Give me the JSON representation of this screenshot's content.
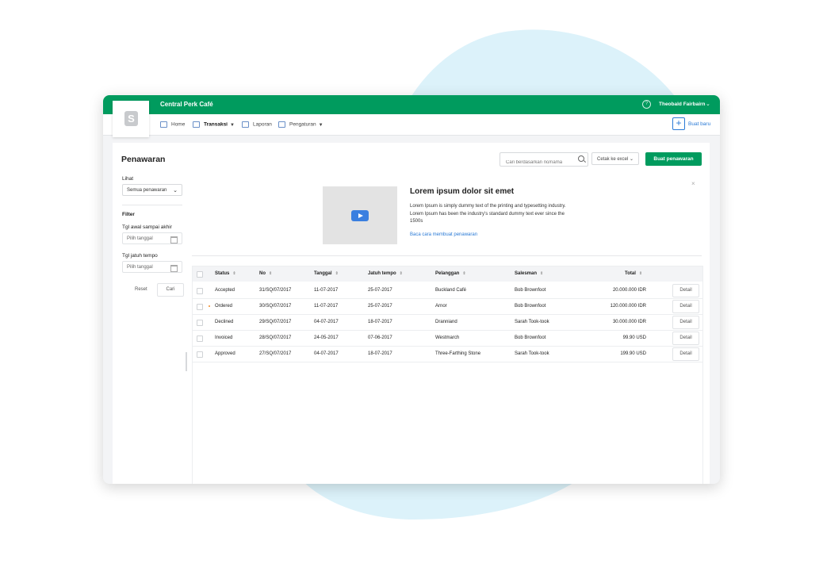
{
  "colors": {
    "brand": "#009b5e",
    "link": "#2a7ad6",
    "blob": "#dcf2fa",
    "ordered_dot": "#f08a24"
  },
  "app": {
    "name": "Central Perk Café",
    "user": "Theobald Fairbairn",
    "logo_letter": "S"
  },
  "nav": {
    "items": [
      {
        "label": "Home",
        "icon": "home-icon"
      },
      {
        "label": "Transaksi",
        "icon": "transaction-icon",
        "active": true
      },
      {
        "label": "Laporan",
        "icon": "report-icon"
      },
      {
        "label": "Pengaturan",
        "icon": "settings-icon"
      }
    ],
    "new_label": "Buat baru",
    "new_symbol": "+"
  },
  "page": {
    "title": "Penawaran"
  },
  "toolbar": {
    "search_placeholder": "Cari berdasarkan no/nama",
    "export_label": "Cetak ke excel",
    "create_label": "Buat penawaran"
  },
  "filters": {
    "view_label": "Lihat",
    "view_value": "Semua penawaran",
    "filter_label": "Filter",
    "start_label": "Tgl awal sampai akhir",
    "start_placeholder": "Pilih tanggal",
    "due_label": "Tgl jatuh tempo",
    "due_placeholder": "Pilih tanggal",
    "reset_label": "Reset",
    "search_label": "Cari"
  },
  "promo": {
    "title": "Lorem ipsum dolor sit emet",
    "text": "Lorem Ipsum is simply dummy text of the printing and typesetting industry. Lorem Ipsum has been the industry's standard dummy text ever since the 1500s",
    "link": "Baca cara membuat penawaran",
    "close": "×"
  },
  "table": {
    "headers": [
      "Status",
      "No",
      "Tanggal",
      "Jatuh tempo",
      "Pelanggan",
      "Salesman",
      "Total"
    ],
    "detail_label": "Detail",
    "rows": [
      {
        "status": "Accepted",
        "no": "31/SQ/07/2017",
        "tanggal": "11-07-2017",
        "jatuh_tempo": "25-07-2017",
        "pelanggan": "Buckland Café",
        "salesman": "Bob Brownfoot",
        "total": "20.000.000 IDR"
      },
      {
        "status": "Ordered",
        "no": "30/SQ/07/2017",
        "tanggal": "11-07-2017",
        "jatuh_tempo": "25-07-2017",
        "pelanggan": "Arnor",
        "salesman": "Bob Brownfoot",
        "total": "120.000.000 IDR"
      },
      {
        "status": "Declined",
        "no": "29/SQ/07/2017",
        "tanggal": "04-07-2017",
        "jatuh_tempo": "18-07-2017",
        "pelanggan": "Dranniand",
        "salesman": "Sarah Took-took",
        "total": "30.000.000 IDR"
      },
      {
        "status": "Invoiced",
        "no": "28/SQ/07/2017",
        "tanggal": "24-05-2017",
        "jatuh_tempo": "07-06-2017",
        "pelanggan": "Westmarch",
        "salesman": "Bob Brownfoot",
        "total": "99.90 USD"
      },
      {
        "status": "Approved",
        "no": "27/SQ/07/2017",
        "tanggal": "04-07-2017",
        "jatuh_tempo": "18-07-2017",
        "pelanggan": "Three-Farthing Stone",
        "salesman": "Sarah Took-took",
        "total": "199.90 USD"
      }
    ]
  }
}
